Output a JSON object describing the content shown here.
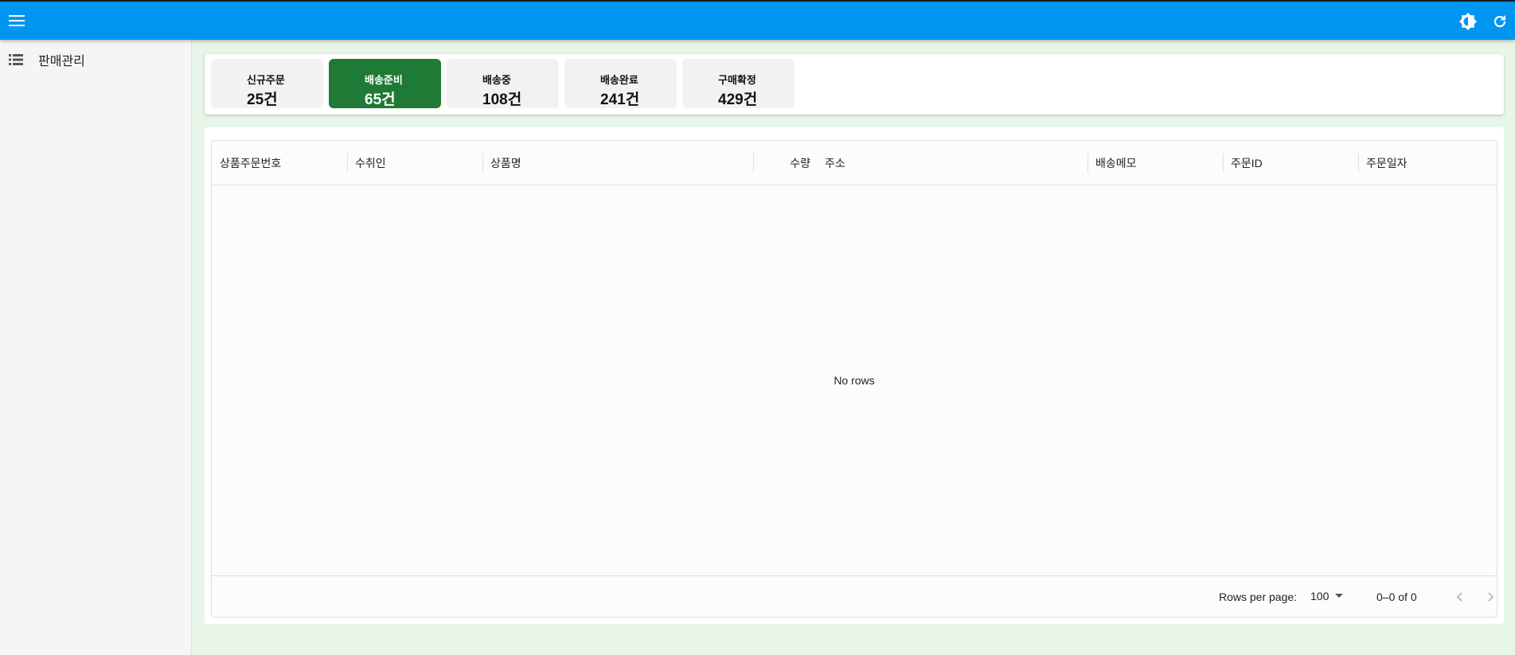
{
  "appbar": {
    "menu_icon": "hamburger-menu-icon",
    "theme_icon": "brightness-icon",
    "refresh_icon": "refresh-icon",
    "color": "#0096ef"
  },
  "sidebar": {
    "items": [
      {
        "label": "판매관리",
        "icon": "list-icon"
      }
    ]
  },
  "status_cards": [
    {
      "label": "신규주문",
      "count": "25건",
      "active": false
    },
    {
      "label": "배송준비",
      "count": "65건",
      "active": true
    },
    {
      "label": "배송중",
      "count": "108건",
      "active": false
    },
    {
      "label": "배송완료",
      "count": "241건",
      "active": false
    },
    {
      "label": "구매확정",
      "count": "429건",
      "active": false
    }
  ],
  "colors": {
    "active_card": "#1f7a35",
    "card": "#f2f2f2",
    "background": "#e8f5e9"
  },
  "grid": {
    "columns": [
      "상품주문번호",
      "수취인",
      "상품명",
      "수량",
      "주소",
      "배송메모",
      "주문ID",
      "주문일자"
    ],
    "empty_text": "No rows",
    "footer": {
      "rows_per_page_label": "Rows per page:",
      "rows_per_page_value": "100",
      "range_text": "0–0 of 0"
    }
  }
}
